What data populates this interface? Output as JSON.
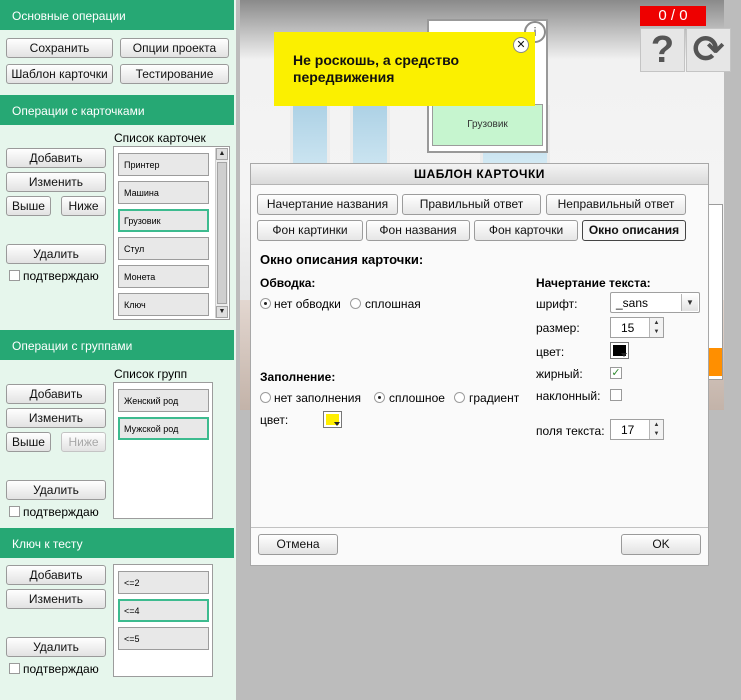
{
  "sections": {
    "basic": "Основные операции",
    "cards": "Операции с карточками",
    "groups": "Операции с группами",
    "key": "Ключ к тесту"
  },
  "basic_ops": {
    "save": "Сохранить",
    "project_options": "Опции проекта",
    "card_template": "Шаблон карточки",
    "testing": "Тестирование"
  },
  "card_ops": {
    "add": "Добавить",
    "edit": "Изменить",
    "up": "Выше",
    "down": "Ниже",
    "delete": "Удалить",
    "confirm": "подтверждаю",
    "list_title": "Список карточек",
    "items": [
      "Принтер",
      "Машина",
      "Грузовик",
      "Стул",
      "Монета",
      "Ключ"
    ]
  },
  "group_ops": {
    "add": "Добавить",
    "edit": "Изменить",
    "up": "Выше",
    "down": "Ниже",
    "delete": "Удалить",
    "confirm": "подтверждаю",
    "list_title": "Список групп",
    "items": [
      "Женский род",
      "Мужской род"
    ]
  },
  "key_ops": {
    "add": "Добавить",
    "edit": "Изменить",
    "delete": "Удалить",
    "confirm": "подтверждаю",
    "items": [
      "<=2",
      "<=4",
      "<=5"
    ]
  },
  "scene": {
    "score": "0 / 0",
    "help_icon": "?",
    "reload_icon": "⟳",
    "info_icon": "i",
    "tooltip": "Не роскошь, а средство передвижения",
    "tooltip_close": "✕",
    "bg_card_label": "Грузовик"
  },
  "dialog": {
    "title": "ШАБЛОН КАРТОЧКИ",
    "tabs_row1": [
      "Начертание названия",
      "Правильный ответ",
      "Неправильный ответ"
    ],
    "tabs_row2": [
      "Фон картинки",
      "Фон названия",
      "Фон карточки",
      "Окно описания"
    ],
    "section_title": "Окно описания карточки:",
    "border": {
      "label": "Обводка:",
      "options": [
        "нет обводки",
        "сплошная"
      ],
      "selected": 0
    },
    "fill": {
      "label": "Заполнение:",
      "options": [
        "нет заполнения",
        "сплошное",
        "градиент"
      ],
      "selected": 1,
      "color_label": "цвет:",
      "color": "#ffee00"
    },
    "text_style": {
      "label": "Начертание текста:",
      "font_label": "шрифт:",
      "font_value": "_sans",
      "size_label": "размер:",
      "size_value": "15",
      "color_label": "цвет:",
      "color": "#000000",
      "bold_label": "жирный:",
      "bold": true,
      "italic_label": "наклонный:",
      "italic": false,
      "padding_label": "поля текста:",
      "padding_value": "17"
    },
    "cancel": "Отмена",
    "ok": "OK"
  },
  "colors": {
    "section_header": "#26a874",
    "panel_bg": "#e6f6ec",
    "selected_outline": "#3dbb8f",
    "tooltip_bg": "#fbf000",
    "score_bg": "#ee0000"
  }
}
